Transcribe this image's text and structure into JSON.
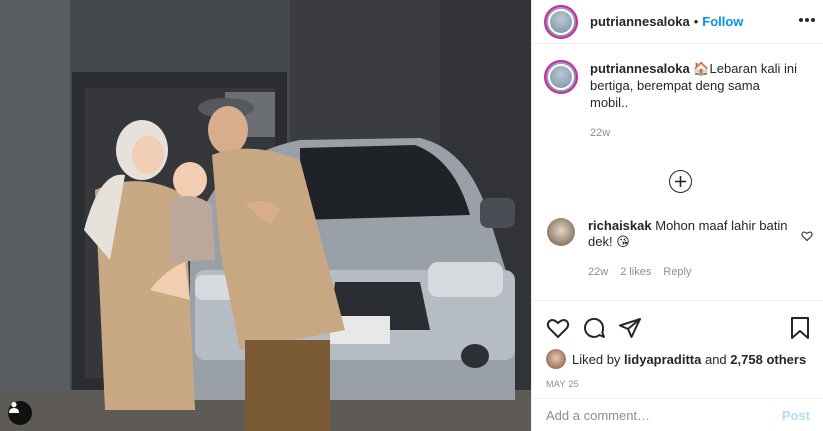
{
  "post": {
    "author": "putriannesaloka",
    "dot": "•",
    "follow_label": "Follow",
    "caption_user": "putriannesaloka",
    "caption_emoji": "🏠",
    "caption_text": "Lebaran kali ini bertiga, berempat deng sama mobil..",
    "caption_time": "22w",
    "comment": {
      "user": "richaiskak",
      "text": "Mohon maaf lahir batin dek!",
      "emoji": "😘",
      "time": "22w",
      "likes": "2 likes",
      "reply": "Reply"
    },
    "liked_by_prefix": "Liked by ",
    "liked_by_user": "lidyapraditta",
    "liked_by_and": " and ",
    "liked_by_count": "2,758 others",
    "date": "MAY 25",
    "add_comment_placeholder": "Add a comment…",
    "post_label": "Post"
  },
  "icons": {
    "more": "more-options-icon",
    "load_more": "plus-circle-icon",
    "like_small": "heart-icon",
    "like": "heart-icon",
    "comment": "comment-icon",
    "share": "paper-plane-icon",
    "save": "bookmark-icon",
    "user_tag": "person-icon"
  },
  "colors": {
    "link": "#0095f6",
    "post_disabled": "#b2dffc",
    "meta": "#8e8e8e"
  }
}
